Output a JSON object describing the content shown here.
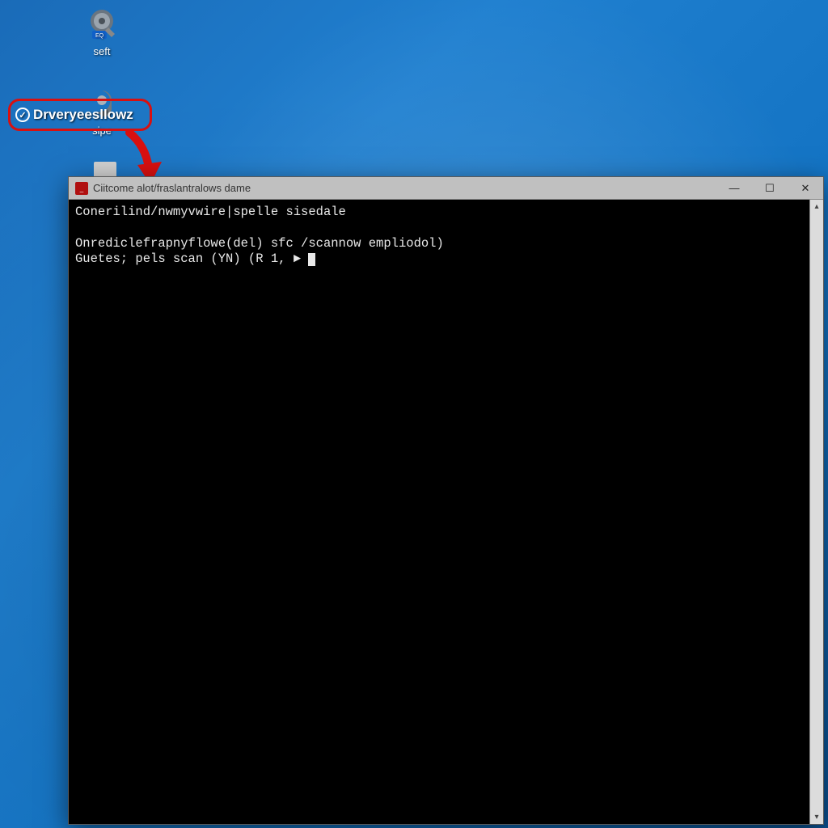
{
  "desktop": {
    "icons": [
      {
        "label": "seft"
      },
      {
        "label": "sipe"
      }
    ]
  },
  "highlight": {
    "text": "Drveryeesllowz"
  },
  "cmd": {
    "title": "Ciitcome alot/fraslantralows dame",
    "line1": "Conerilind/nwmyvwire|spelle sisedale",
    "line2": "",
    "line3": "Onrediclefrapnyflowe(del) sfc /scannow empliodol)",
    "line4": "Guetes; pels scan (YN) (R 1, ► "
  },
  "window": {
    "minimize": "—",
    "maximize": "☐",
    "close": "✕"
  }
}
